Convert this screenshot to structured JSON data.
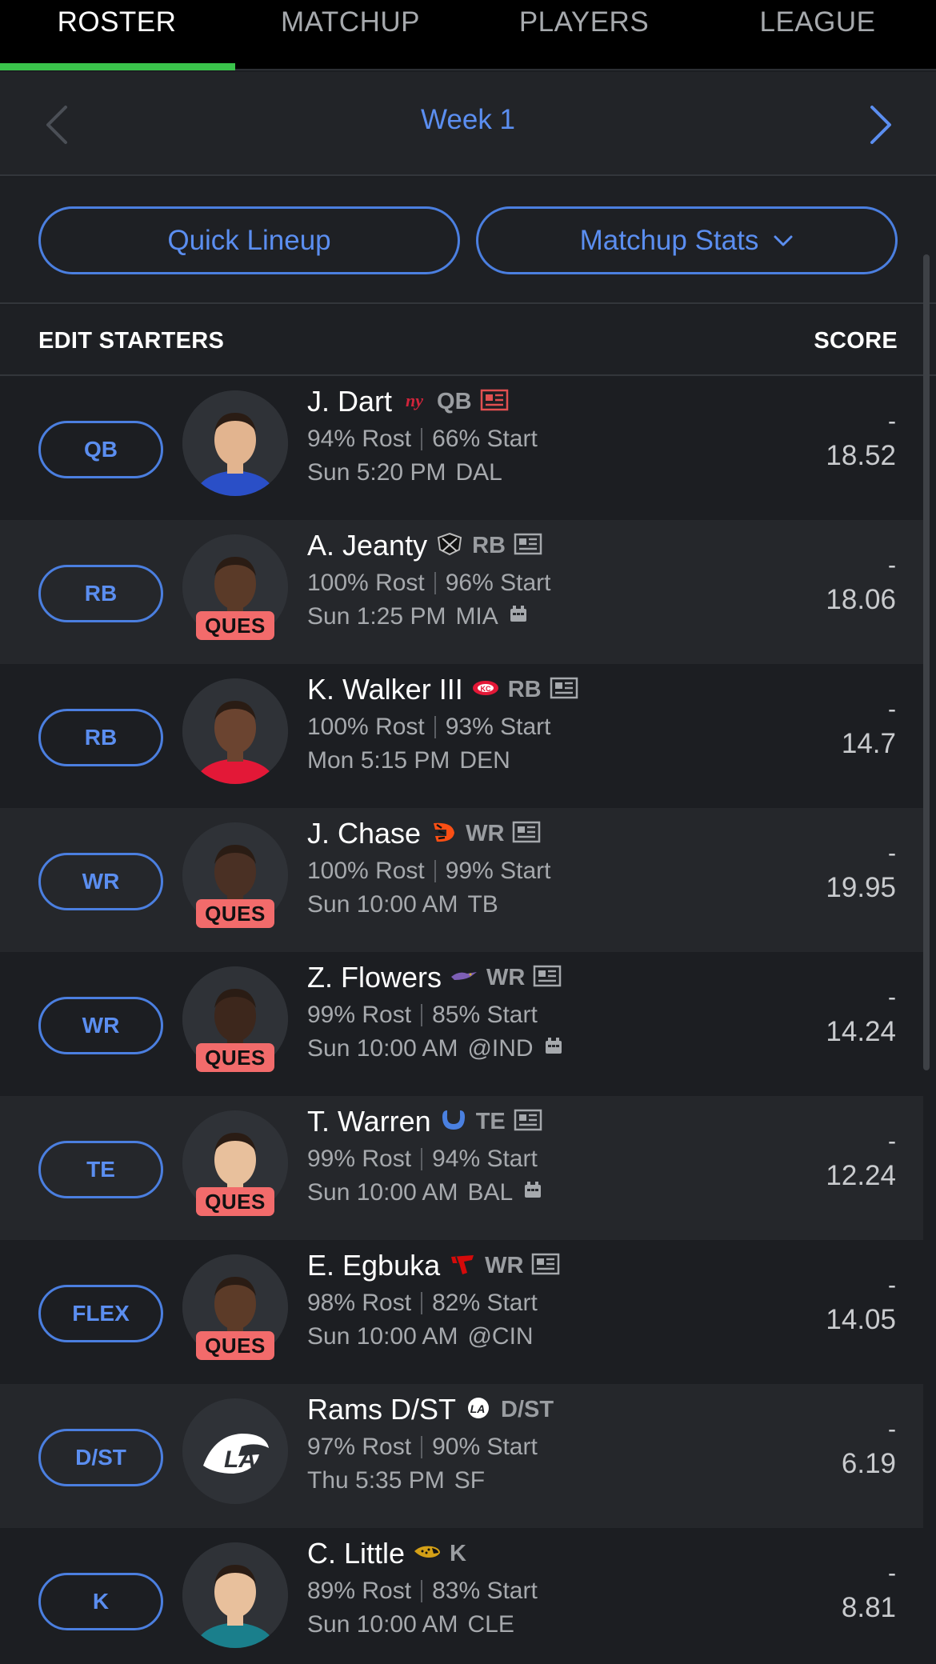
{
  "nav": {
    "tabs": [
      {
        "label": "ROSTER",
        "active": true
      },
      {
        "label": "MATCHUP",
        "active": false
      },
      {
        "label": "PLAYERS",
        "active": false
      },
      {
        "label": "LEAGUE",
        "active": false
      }
    ]
  },
  "week": {
    "title": "Week 1",
    "prev_icon": "chevron-left-icon",
    "next_icon": "chevron-right-icon"
  },
  "actions": {
    "quick_lineup": "Quick Lineup",
    "matchup_stats": "Matchup Stats"
  },
  "table": {
    "edit_starters": "EDIT STARTERS",
    "score_header": "SCORE"
  },
  "colors": {
    "accent": "#5b8ef0",
    "active_tab": "#3ac34b",
    "injury_badge": "#f26b6b"
  },
  "players": [
    {
      "slot": "QB",
      "name": "J. Dart",
      "team_icon": "giants-logo",
      "pos": "QB",
      "rost": "94% Rost",
      "start": "66% Start",
      "game": "Sun 5:20 PM",
      "opp": "DAL",
      "projected": "18.52",
      "score": "-",
      "ques": "",
      "news": "news-icon-red",
      "weather": false
    },
    {
      "slot": "RB",
      "name": "A. Jeanty",
      "team_icon": "raiders-logo",
      "pos": "RB",
      "rost": "100% Rost",
      "start": "96% Start",
      "game": "Sun 1:25 PM",
      "opp": "MIA",
      "projected": "18.06",
      "score": "-",
      "ques": "QUES",
      "news": "news-icon",
      "weather": true
    },
    {
      "slot": "RB",
      "name": "K. Walker III",
      "team_icon": "chiefs-logo",
      "pos": "RB",
      "rost": "100% Rost",
      "start": "93% Start",
      "game": "Mon 5:15 PM",
      "opp": "DEN",
      "projected": "14.7",
      "score": "-",
      "ques": "",
      "news": "news-icon",
      "weather": false
    },
    {
      "slot": "WR",
      "name": "J. Chase",
      "team_icon": "bengals-logo",
      "pos": "WR",
      "rost": "100% Rost",
      "start": "99% Start",
      "game": "Sun 10:00 AM",
      "opp": "TB",
      "projected": "19.95",
      "score": "-",
      "ques": "QUES",
      "news": "news-icon",
      "weather": false
    },
    {
      "slot": "WR",
      "name": "Z. Flowers",
      "team_icon": "ravens-logo",
      "pos": "WR",
      "rost": "99% Rost",
      "start": "85% Start",
      "game": "Sun 10:00 AM",
      "opp": "@IND",
      "projected": "14.24",
      "score": "-",
      "ques": "QUES",
      "news": "news-icon",
      "weather": true
    },
    {
      "slot": "TE",
      "name": "T. Warren",
      "team_icon": "colts-logo",
      "pos": "TE",
      "rost": "99% Rost",
      "start": "94% Start",
      "game": "Sun 10:00 AM",
      "opp": "BAL",
      "projected": "12.24",
      "score": "-",
      "ques": "QUES",
      "news": "news-icon",
      "weather": true
    },
    {
      "slot": "FLEX",
      "name": "E. Egbuka",
      "team_icon": "buccaneers-logo",
      "pos": "WR",
      "rost": "98% Rost",
      "start": "82% Start",
      "game": "Sun 10:00 AM",
      "opp": "@CIN",
      "projected": "14.05",
      "score": "-",
      "ques": "QUES",
      "news": "news-icon",
      "weather": false
    },
    {
      "slot": "D/ST",
      "name": "Rams D/ST",
      "team_icon": "rams-logo",
      "pos": "D/ST",
      "rost": "97% Rost",
      "start": "90% Start",
      "game": "Thu 5:35 PM",
      "opp": "SF",
      "projected": "6.19",
      "score": "-",
      "ques": "",
      "news": "",
      "weather": false
    },
    {
      "slot": "K",
      "name": "C. Little",
      "team_icon": "jaguars-logo",
      "pos": "K",
      "rost": "89% Rost",
      "start": "83% Start",
      "game": "Sun 10:00 AM",
      "opp": "CLE",
      "projected": "8.81",
      "score": "-",
      "ques": "",
      "news": "",
      "weather": false
    }
  ]
}
